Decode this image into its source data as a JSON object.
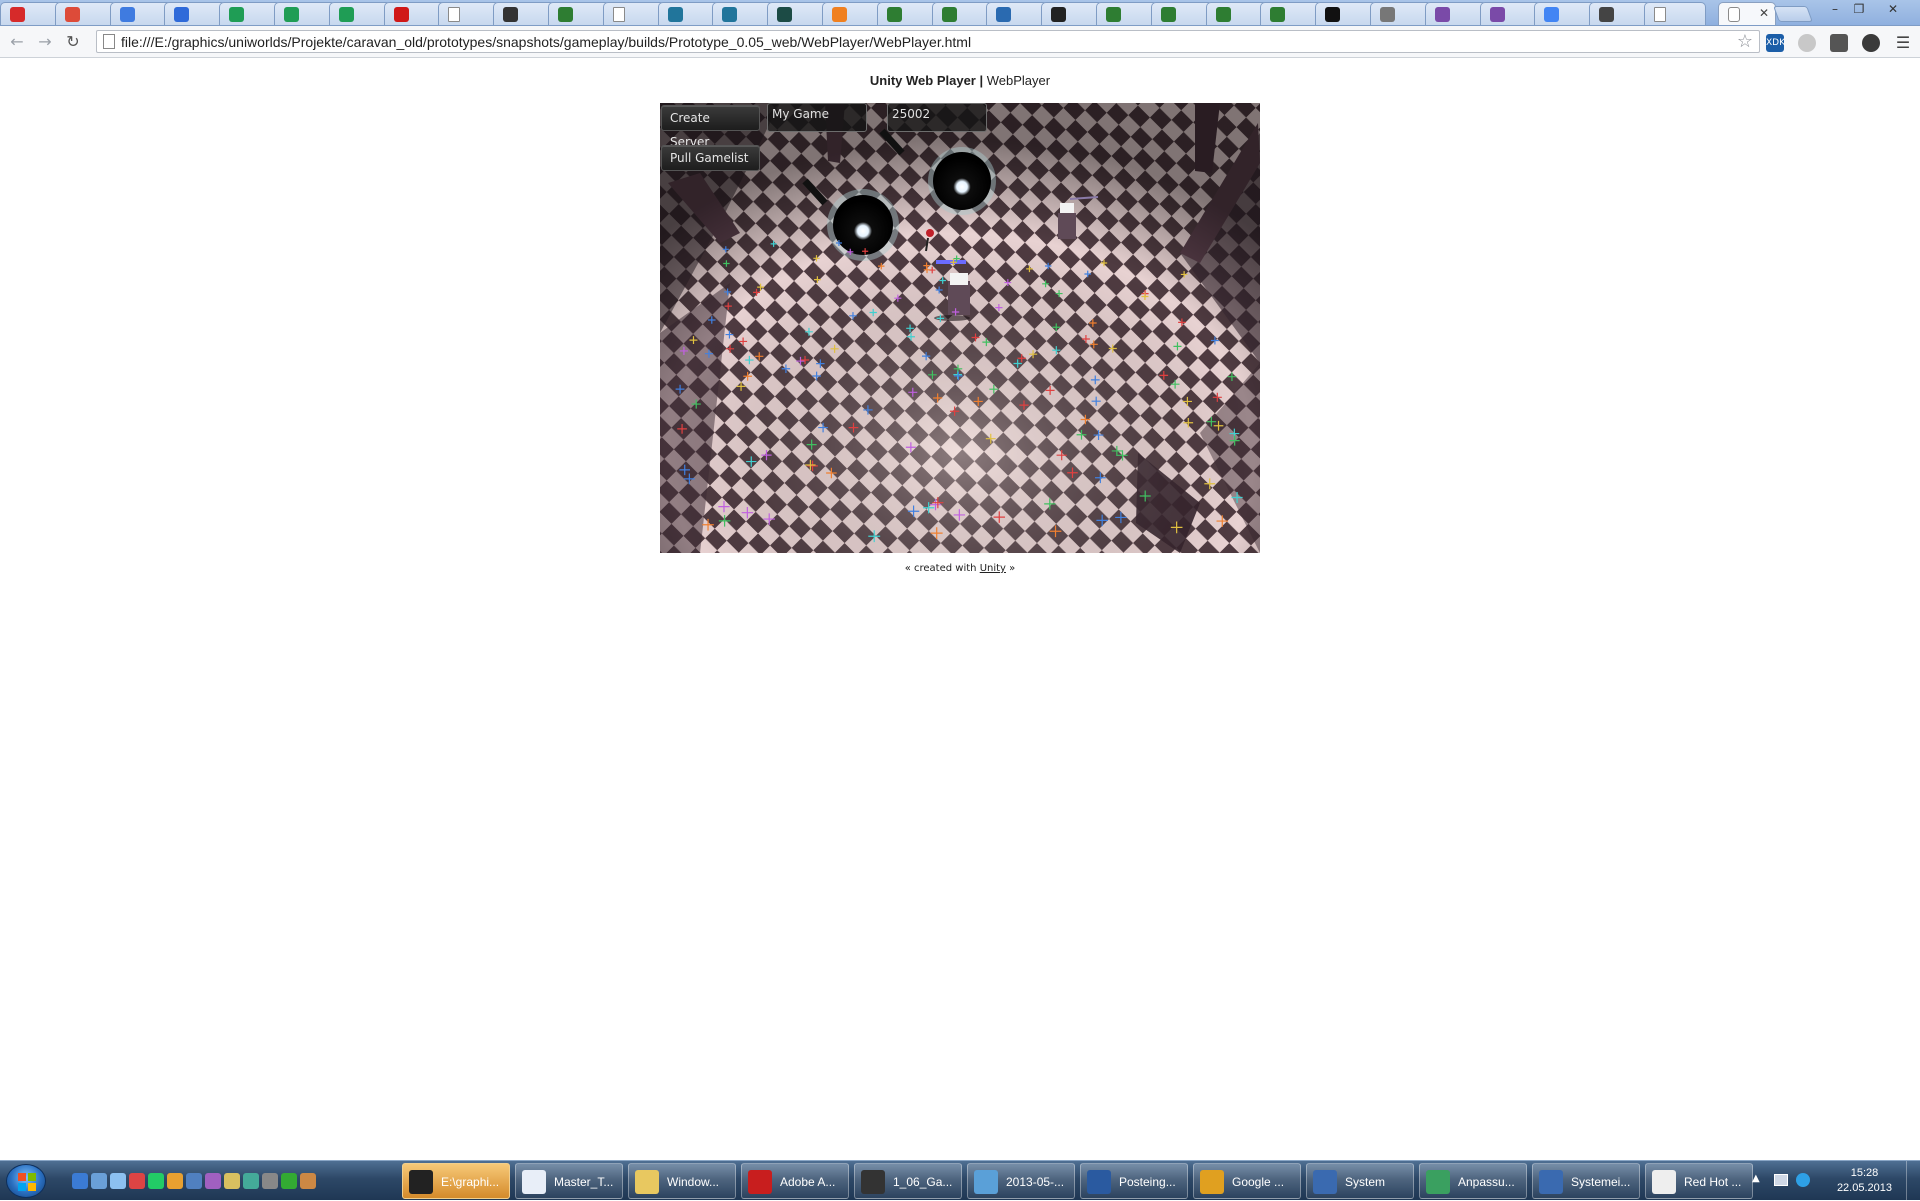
{
  "browser": {
    "url": "file:///E:/graphics/uniworlds/Projekte/caravan_old/prototypes/snapshots/gameplay/builds/Prototype_0.05_web/WebPlayer/WebPlayer.html",
    "active_tab_close": "✕",
    "tab_icons": [
      "pocket-icon",
      "google-plus-icon",
      "calendar-icon",
      "delicious-icon",
      "sheets-icon",
      "sheets-icon",
      "sheets-icon",
      "record-icon",
      "page-icon",
      "ghost-icon",
      "greenapp-icon",
      "page-icon",
      "wordpress-icon",
      "wordpress-icon",
      "d-icon",
      "swirl-icon",
      "greenapp-icon",
      "greenapp-icon",
      "bird-icon",
      "eye-icon",
      "greenapp-icon",
      "greenapp-icon",
      "greenapp-icon",
      "greenapp-icon",
      "penguin-icon",
      "image-icon",
      "k-icon",
      "k-icon",
      "google-icon",
      "mask-icon",
      "page-icon"
    ],
    "extensions": [
      "xdk-icon",
      "gray-circle-icon",
      "puzzle-icon",
      "gauge-icon",
      "menu-icon"
    ],
    "colors": {
      "accent": "#8fb0df"
    }
  },
  "page": {
    "title_bold": "Unity Web Player",
    "separator": " | ",
    "title_rest": "WebPlayer",
    "footer_prefix": "« created with ",
    "footer_link": "Unity",
    "footer_suffix": " »"
  },
  "game_gui": {
    "create_server": "Create Server",
    "pull_gamelist": "Pull Gamelist",
    "game_name": "My Game",
    "port": "25002"
  },
  "taskbar": {
    "tasks": [
      {
        "label": "E:\\graphi...",
        "icon": "xmind-icon",
        "active": true
      },
      {
        "label": "Master_T...",
        "icon": "odt-icon",
        "active": false
      },
      {
        "label": "Window...",
        "icon": "folder-icon",
        "active": false
      },
      {
        "label": "Adobe A...",
        "icon": "acrobat-icon",
        "active": false
      },
      {
        "label": "1_06_Ga...",
        "icon": "inkscape-icon",
        "active": false
      },
      {
        "label": "2013-05-...",
        "icon": "picture-icon",
        "active": false
      },
      {
        "label": "Posteing...",
        "icon": "thunderbird-icon",
        "active": false
      },
      {
        "label": "Google ...",
        "icon": "chrome-icon",
        "active": false
      },
      {
        "label": "System",
        "icon": "system-icon",
        "active": false
      },
      {
        "label": "Anpassu...",
        "icon": "personalize-icon",
        "active": false
      },
      {
        "label": "Systemei...",
        "icon": "system-icon",
        "active": false
      },
      {
        "label": "Red Hot ...",
        "icon": "winamp-icon",
        "active": false
      }
    ],
    "time": "15:28",
    "date": "22.05.2013"
  }
}
